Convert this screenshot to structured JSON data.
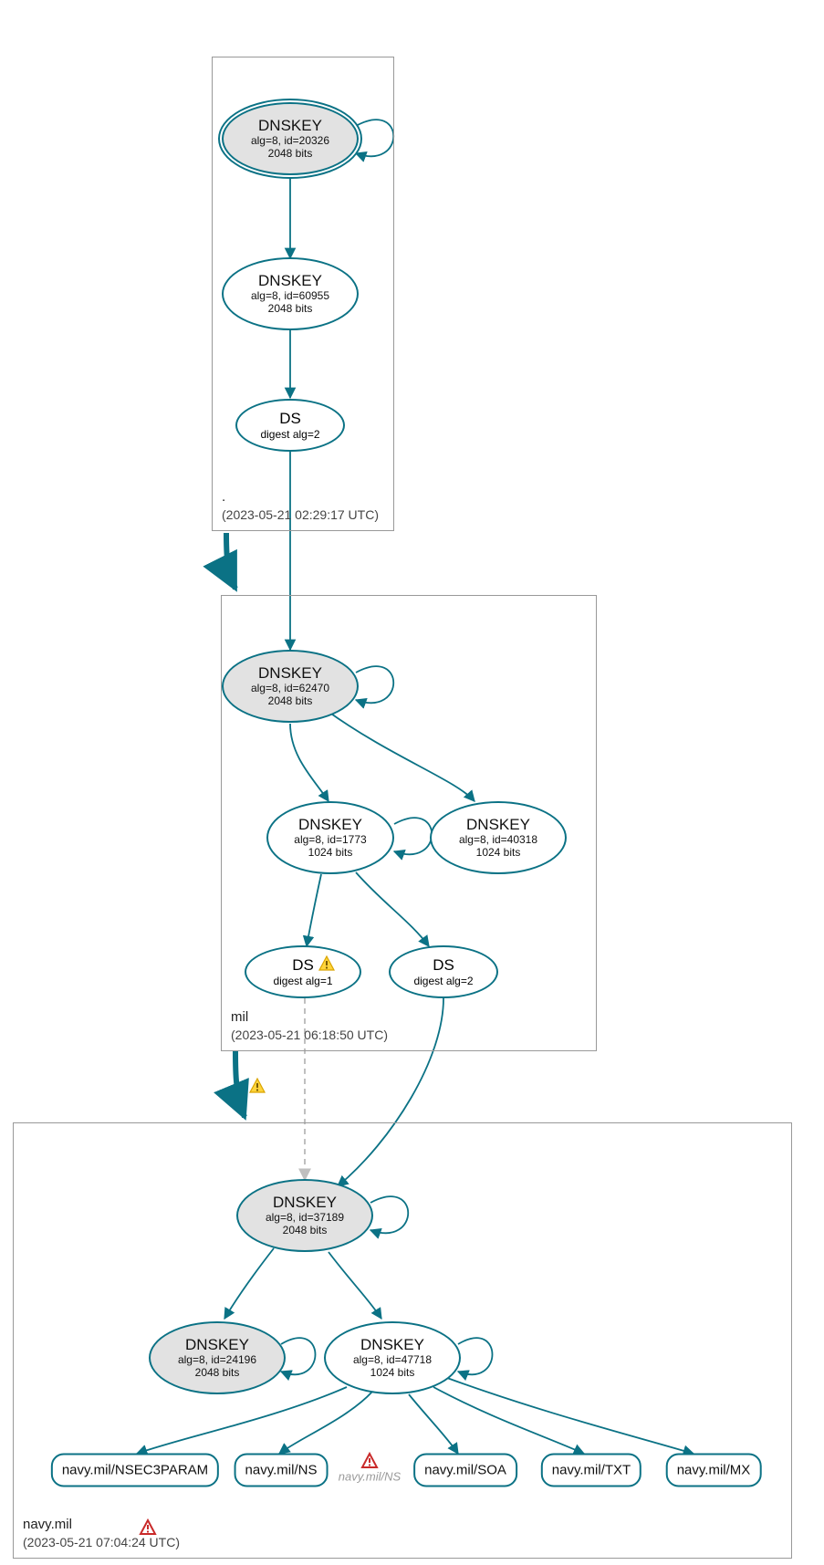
{
  "zones": {
    "root": {
      "name": ".",
      "timestamp": "(2023-05-21 02:29:17 UTC)"
    },
    "mil": {
      "name": "mil",
      "timestamp": "(2023-05-21 06:18:50 UTC)"
    },
    "navy": {
      "name": "navy.mil",
      "timestamp": "(2023-05-21 07:04:24 UTC)"
    }
  },
  "nodes": {
    "root_ksk": {
      "title": "DNSKEY",
      "line1": "alg=8, id=20326",
      "line2": "2048 bits"
    },
    "root_zsk": {
      "title": "DNSKEY",
      "line1": "alg=8, id=60955",
      "line2": "2048 bits"
    },
    "root_ds": {
      "title": "DS",
      "line1": "digest alg=2"
    },
    "mil_ksk": {
      "title": "DNSKEY",
      "line1": "alg=8, id=62470",
      "line2": "2048 bits"
    },
    "mil_zsk": {
      "title": "DNSKEY",
      "line1": "alg=8, id=1773",
      "line2": "1024 bits"
    },
    "mil_zsk2": {
      "title": "DNSKEY",
      "line1": "alg=8, id=40318",
      "line2": "1024 bits"
    },
    "mil_ds1": {
      "title": "DS",
      "line1": "digest alg=1"
    },
    "mil_ds2": {
      "title": "DS",
      "line1": "digest alg=2"
    },
    "navy_ksk": {
      "title": "DNSKEY",
      "line1": "alg=8, id=37189",
      "line2": "2048 bits"
    },
    "navy_ksk2": {
      "title": "DNSKEY",
      "line1": "alg=8, id=24196",
      "line2": "2048 bits"
    },
    "navy_zsk": {
      "title": "DNSKEY",
      "line1": "alg=8, id=47718",
      "line2": "1024 bits"
    }
  },
  "records": {
    "nsec3": "navy.mil/NSEC3PARAM",
    "ns": "navy.mil/NS",
    "ns2": "navy.mil/NS",
    "soa": "navy.mil/SOA",
    "txt": "navy.mil/TXT",
    "mx": "navy.mil/MX"
  }
}
